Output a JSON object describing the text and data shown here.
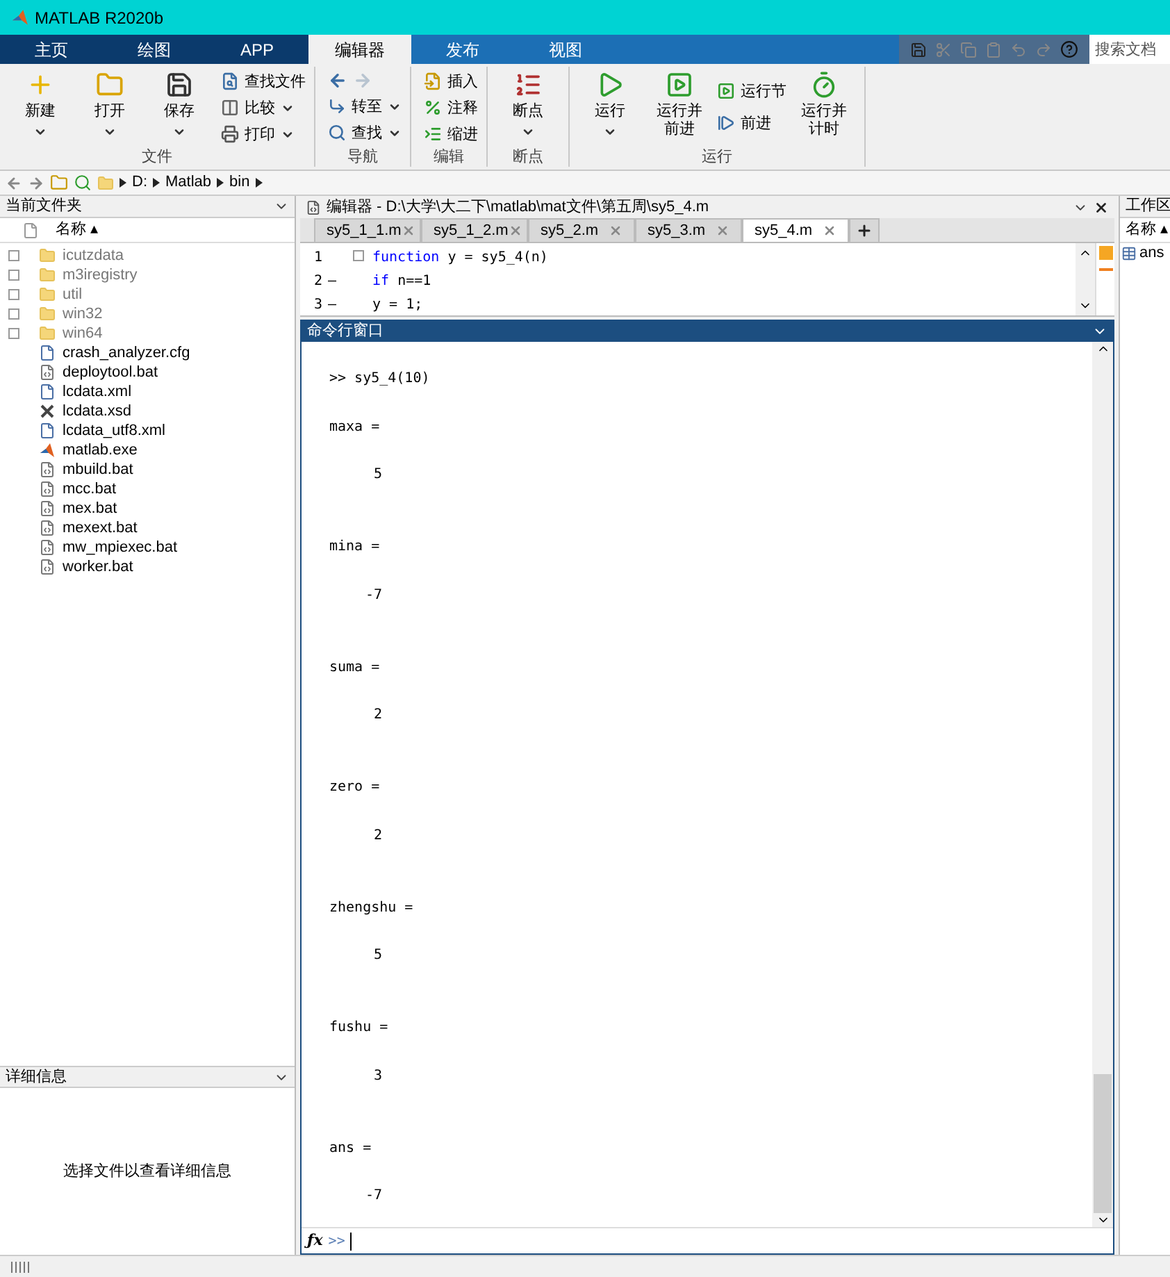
{
  "window": {
    "title": "MATLAB R2020b"
  },
  "tabs": [
    {
      "label": "主页",
      "selected": false
    },
    {
      "label": "绘图",
      "selected": false
    },
    {
      "label": "APP",
      "selected": false
    },
    {
      "label": "编辑器",
      "selected": true
    },
    {
      "label": "发布",
      "selected": false
    },
    {
      "label": "视图",
      "selected": false
    }
  ],
  "search": {
    "placeholder": "搜索文档"
  },
  "toolstrip": [
    {
      "label": "文件",
      "items": [
        {
          "label": "新建",
          "kind": "large",
          "dropdown": true
        },
        {
          "label": "打开",
          "kind": "large",
          "dropdown": true
        },
        {
          "label": "保存",
          "kind": "large",
          "dropdown": true
        },
        {
          "label": "查找文件",
          "kind": "small",
          "dropdown": false
        },
        {
          "label": "比较",
          "kind": "small",
          "dropdown": true
        },
        {
          "label": "打印",
          "kind": "small",
          "dropdown": true
        }
      ]
    },
    {
      "label": "导航",
      "items": [
        {
          "label": "转至",
          "kind": "small",
          "dropdown": true
        },
        {
          "label": "查找",
          "kind": "small",
          "dropdown": true
        }
      ]
    },
    {
      "label": "编辑",
      "items": [
        {
          "label": "插入",
          "kind": "small",
          "dropdown": false
        },
        {
          "label": "注释",
          "kind": "small",
          "dropdown": false
        },
        {
          "label": "缩进",
          "kind": "small",
          "dropdown": false
        }
      ]
    },
    {
      "label": "断点",
      "items": [
        {
          "label": "断点",
          "kind": "large",
          "dropdown": true
        }
      ]
    },
    {
      "label": "运行",
      "items": [
        {
          "label": "运行",
          "kind": "large",
          "dropdown": true
        },
        {
          "label": "运行并前进",
          "kind": "large",
          "dropdown": false
        },
        {
          "label": "运行节",
          "kind": "small",
          "dropdown": false
        },
        {
          "label": "前进",
          "kind": "small",
          "dropdown": false
        },
        {
          "label": "运行并计时",
          "kind": "large",
          "dropdown": false
        }
      ]
    }
  ],
  "address": {
    "path": [
      "D:",
      "Matlab",
      "bin"
    ]
  },
  "current_folder": {
    "title": "当前文件夹",
    "column": "名称 ▴",
    "files": [
      {
        "name": "icutzdata",
        "kind": "folder"
      },
      {
        "name": "m3iregistry",
        "kind": "folder"
      },
      {
        "name": "util",
        "kind": "folder"
      },
      {
        "name": "win32",
        "kind": "folder"
      },
      {
        "name": "win64",
        "kind": "folder"
      },
      {
        "name": "crash_analyzer.cfg",
        "kind": "doc"
      },
      {
        "name": "deploytool.bat",
        "kind": "bat"
      },
      {
        "name": "lcdata.xml",
        "kind": "doc"
      },
      {
        "name": "lcdata.xsd",
        "kind": "schema"
      },
      {
        "name": "lcdata_utf8.xml",
        "kind": "doc"
      },
      {
        "name": "matlab.exe",
        "kind": "exe"
      },
      {
        "name": "mbuild.bat",
        "kind": "bat"
      },
      {
        "name": "mcc.bat",
        "kind": "bat"
      },
      {
        "name": "mex.bat",
        "kind": "bat"
      },
      {
        "name": "mexext.bat",
        "kind": "bat"
      },
      {
        "name": "mw_mpiexec.bat",
        "kind": "bat"
      },
      {
        "name": "worker.bat",
        "kind": "bat"
      }
    ]
  },
  "details": {
    "title": "详细信息",
    "message": "选择文件以查看详细信息"
  },
  "editor": {
    "title": "编辑器 - D:\\大学\\大二下\\matlab\\mat文件\\第五周\\sy5_4.m",
    "tabs": [
      {
        "label": "sy5_1_1.m",
        "selected": false
      },
      {
        "label": "sy5_1_2.m",
        "selected": false
      },
      {
        "label": "sy5_2.m",
        "selected": false
      },
      {
        "label": "sy5_3.m",
        "selected": false
      },
      {
        "label": "sy5_4.m",
        "selected": true
      }
    ],
    "lines": [
      {
        "number": "1",
        "keyword": "function",
        "rest": " y = sy5_4(n)",
        "fold": true
      },
      {
        "number": "2",
        "marker": "—",
        "keyword": "if",
        "rest": " n==1",
        "fold": false
      },
      {
        "number": "3",
        "marker": "—",
        "rest": "y = 1;",
        "fold": false
      }
    ]
  },
  "command_window": {
    "title": "命令行窗口",
    "function_button": "ƒx",
    "prompt": ">>",
    "lines": [
      {
        "kind": "input",
        "text": ">> sy5_4(10)"
      },
      {
        "kind": "name",
        "text": "maxa ="
      },
      {
        "kind": "value",
        "text": "5"
      },
      {
        "kind": "name",
        "text": "mina ="
      },
      {
        "kind": "value",
        "text": "-7"
      },
      {
        "kind": "name",
        "text": "suma ="
      },
      {
        "kind": "value",
        "text": "2"
      },
      {
        "kind": "name",
        "text": "zero ="
      },
      {
        "kind": "value",
        "text": "2"
      },
      {
        "kind": "name",
        "text": "zhengshu ="
      },
      {
        "kind": "value",
        "text": "5"
      },
      {
        "kind": "name",
        "text": "fushu ="
      },
      {
        "kind": "value",
        "text": "3"
      },
      {
        "kind": "name",
        "text": "ans ="
      },
      {
        "kind": "value",
        "text": "-7"
      }
    ]
  },
  "workspace": {
    "title": "工作区",
    "column": "名称 ▴",
    "variables": [
      "ans"
    ]
  }
}
